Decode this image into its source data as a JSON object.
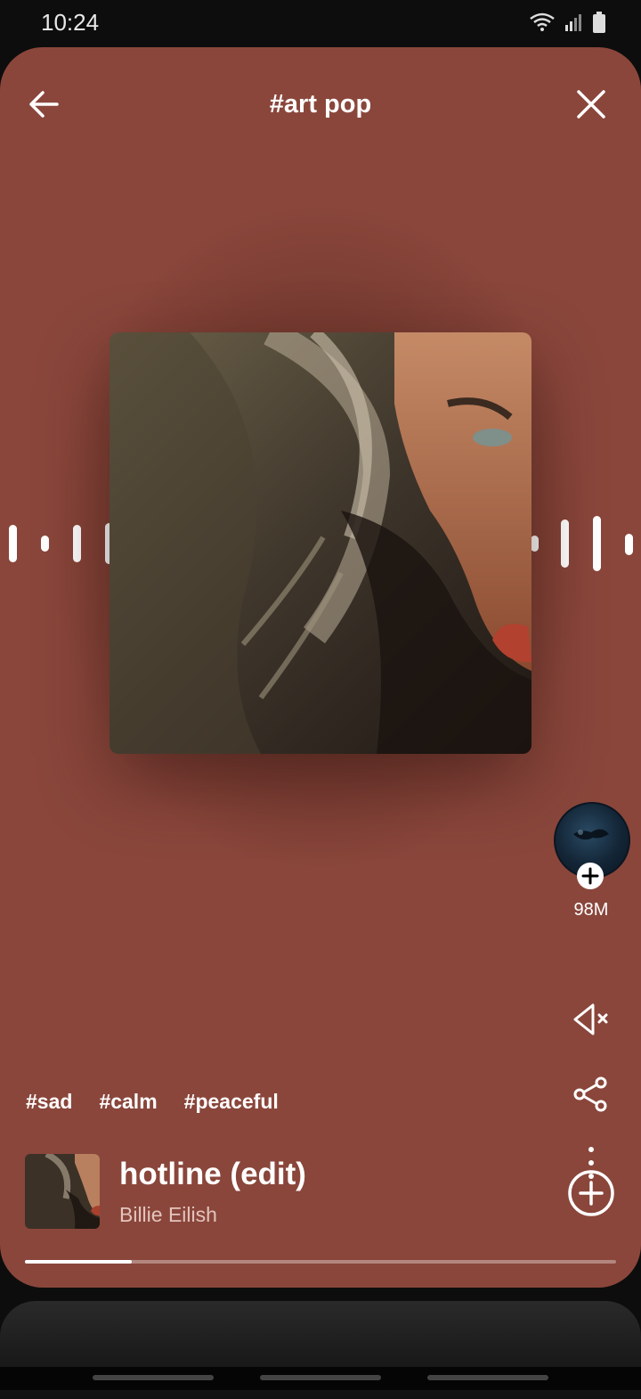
{
  "status_bar": {
    "time": "10:24",
    "icons": [
      "wifi-icon",
      "signal-icon",
      "battery-icon"
    ]
  },
  "header": {
    "title": "#art pop",
    "back_icon": "arrow-left-icon",
    "close_icon": "close-icon"
  },
  "side_actions": {
    "follower_count": "98M",
    "icons": [
      "artist-avatar",
      "plus-icon",
      "mute-icon",
      "share-icon",
      "more-vertical-icon"
    ]
  },
  "tags": [
    "#sad",
    "#calm",
    "#peaceful"
  ],
  "track": {
    "title": "hotline (edit)",
    "artist": "Billie Eilish"
  },
  "progress": {
    "fraction": 0.18
  },
  "colors": {
    "card_background": "#8a463b",
    "accent": "#ffffff"
  }
}
